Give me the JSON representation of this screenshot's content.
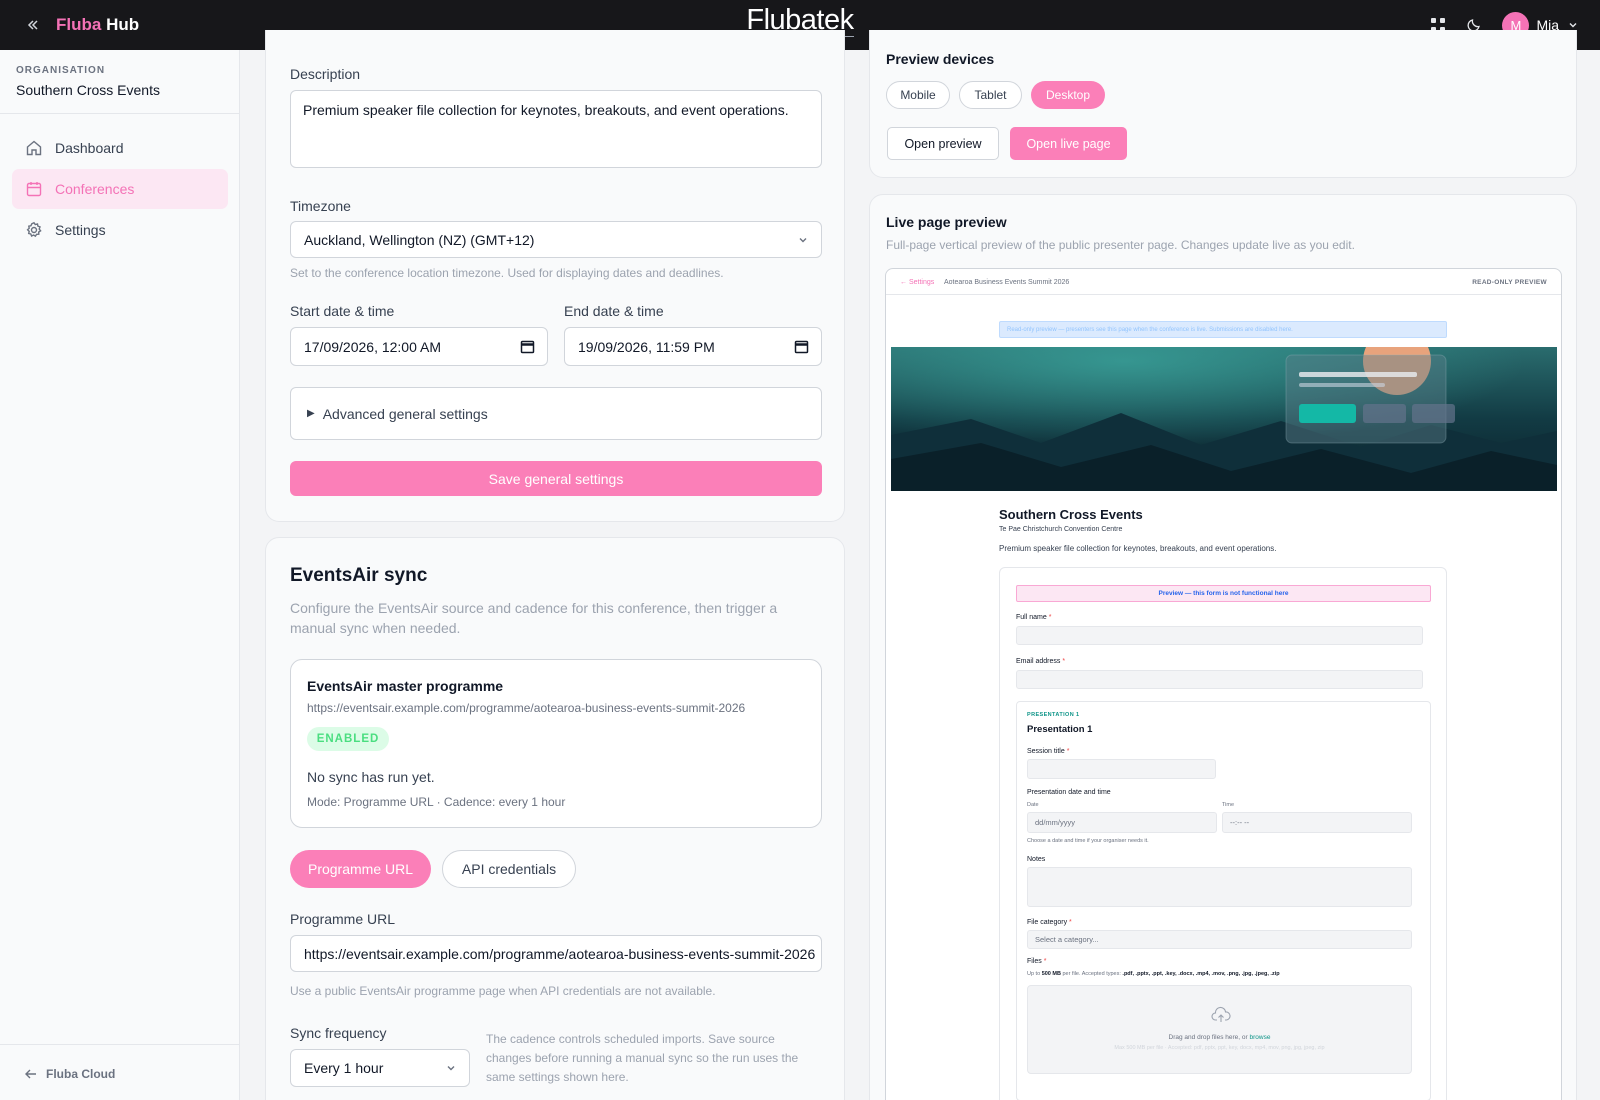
{
  "topbar": {
    "brand_part1": "Fluba",
    "brand_part2": "Hub",
    "center_logo": "Flubatek",
    "user_initial": "M",
    "user_name": "Mia"
  },
  "sidebar": {
    "org_label": "ORGANISATION",
    "org_name": "Southern Cross Events",
    "items": [
      {
        "label": "Dashboard",
        "icon": "home-icon",
        "active": false
      },
      {
        "label": "Conferences",
        "icon": "calendar-icon",
        "active": true
      },
      {
        "label": "Settings",
        "icon": "gear-icon",
        "active": false
      }
    ],
    "footer_link": "Fluba Cloud"
  },
  "general": {
    "description_label": "Description",
    "description_value": "Premium speaker file collection for keynotes, breakouts, and event operations.",
    "timezone_label": "Timezone",
    "timezone_value": "Auckland, Wellington (NZ) (GMT+12)",
    "timezone_hint": "Set to the conference location timezone. Used for displaying dates and deadlines.",
    "start_label": "Start date & time",
    "start_value": "17/09/2026, 12:00 AM",
    "end_label": "End date & time",
    "end_value": "19/09/2026, 11:59 PM",
    "advanced_label": "Advanced general settings",
    "save_label": "Save general settings"
  },
  "eventsair": {
    "title": "EventsAir sync",
    "description": "Configure the EventsAir source and cadence for this conference, then trigger a manual sync when needed.",
    "source_title": "EventsAir master programme",
    "source_url": "https://eventsair.example.com/programme/aotearoa-business-events-summit-2026",
    "badge": "ENABLED",
    "status": "No sync has run yet.",
    "meta": "Mode: Programme URL · Cadence: every 1 hour",
    "tab_url": "Programme URL",
    "tab_api": "API credentials",
    "url_label": "Programme URL",
    "url_value": "https://eventsair.example.com/programme/aotearoa-business-events-summit-2026",
    "url_hint": "Use a public EventsAir programme page when API credentials are not available.",
    "freq_label": "Sync frequency",
    "freq_value": "Every 1 hour",
    "freq_note": "The cadence controls scheduled imports. Save source changes before running a manual sync so the run uses the same settings shown here."
  },
  "preview_devices": {
    "title": "Preview devices",
    "devices": [
      "Mobile",
      "Tablet",
      "Desktop"
    ],
    "active_device": "Desktop",
    "open_preview": "Open preview",
    "open_live": "Open live page"
  },
  "live_preview": {
    "title": "Live page preview",
    "subtitle": "Full-page vertical preview of the public presenter page. Changes update live as you edit.",
    "frame": {
      "back": "← Settings",
      "crumb": "Aotearoa Business Events Summit 2026",
      "readonly": "READ-ONLY PREVIEW",
      "banner": "Read-only preview — presenters see this page when the conference is live. Submissions are disabled here.",
      "event_name": "Southern Cross Events",
      "venue": "Te Pae Christchurch Convention Centre",
      "description": "Premium speaker file collection for keynotes, breakouts, and event operations.",
      "form_notice": "Preview — this form is not functional here",
      "full_name": "Full name",
      "email": "Email address",
      "pres_kicker": "PRESENTATION 1",
      "pres_title": "Presentation 1",
      "session_title": "Session title",
      "datetime_label": "Presentation date and time",
      "date_label": "Date",
      "date_placeholder": "dd/mm/yyyy",
      "time_label": "Time",
      "time_placeholder": "--:-- --",
      "datetime_hint": "Choose a date and time if your organiser needs it.",
      "notes": "Notes",
      "file_category": "File category",
      "category_placeholder": "Select a category...",
      "files": "Files",
      "files_limit_pre": "Up to",
      "files_limit_size": "500 MB",
      "files_limit_post": "per file. Accepted types:",
      "files_types": ".pdf, .pptx, .ppt, .key, .docx, .mp4, .mov, .png, .jpg, .jpeg, .zip",
      "drop_text": "Drag and drop files here, or",
      "drop_link": "browse",
      "drop_sub": "Max 500 MB per file · Accepted: pdf, pptx, ppt, key, docx, mp4, mov, png, jpg, jpeg, zip"
    }
  },
  "colors": {
    "accent": "#fb7fb8",
    "topbar": "#17171a",
    "badge_bg": "#dcfce7",
    "badge_text": "#4ade80"
  }
}
